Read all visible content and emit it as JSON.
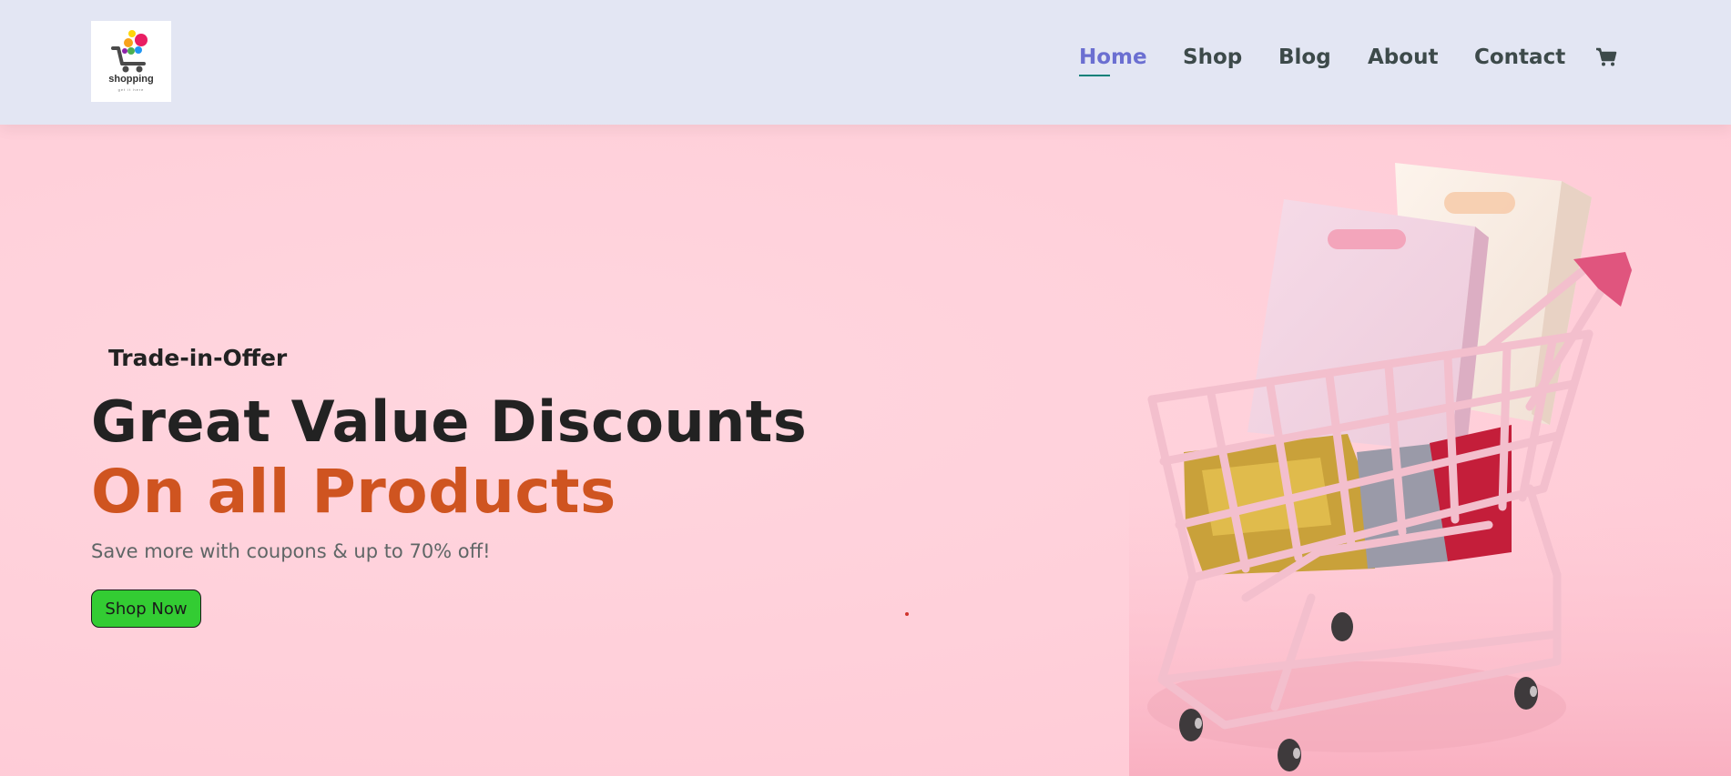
{
  "header": {
    "logo": {
      "text": "shopping",
      "subtext": "get it here"
    },
    "nav": [
      {
        "label": "Home",
        "active": true
      },
      {
        "label": "Shop"
      },
      {
        "label": "Blog"
      },
      {
        "label": "About"
      },
      {
        "label": "Contact"
      }
    ],
    "cart_icon": "shopping-cart-icon"
  },
  "hero": {
    "offer": "Trade-in-Offer",
    "title_line1": "Great Value Discounts",
    "title_line2": "On all Products",
    "subtitle": "Save more with coupons & up to 70% off!",
    "cta_label": "Shop Now"
  },
  "colors": {
    "header_bg": "#e3e6f3",
    "hero_bg": "#ffd0db",
    "accent_orange": "#cf5420",
    "nav_active": "#6b6fd1",
    "button_green": "#33cc33",
    "text_dark": "#222222"
  }
}
